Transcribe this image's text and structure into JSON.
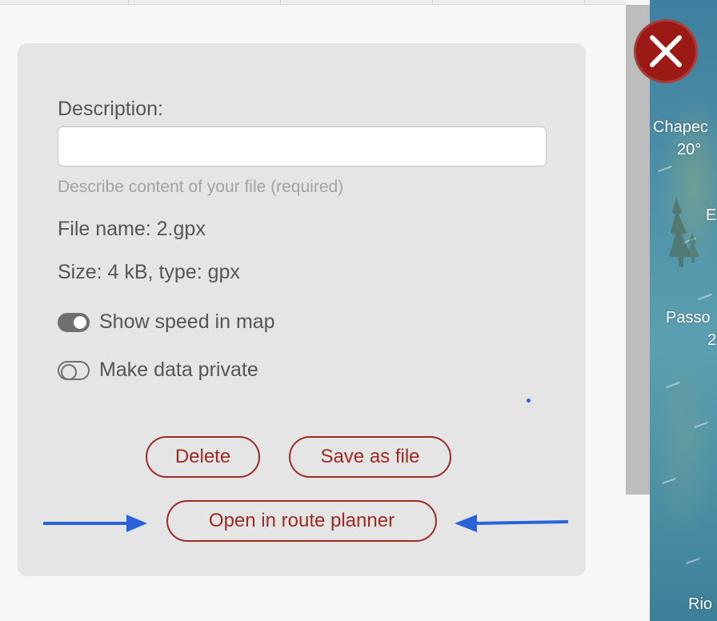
{
  "form": {
    "description_label": "Description:",
    "description_value": "",
    "description_placeholder": "",
    "description_hint": "Describe content of your file (required)",
    "file_name": "File name: 2.gpx",
    "size_type": "Size: 4 kB, type: gpx",
    "toggles": [
      {
        "label": "Show speed in map",
        "on": true
      },
      {
        "label": "Make data private",
        "on": false
      }
    ]
  },
  "buttons": {
    "delete": "Delete",
    "save_as_file": "Save as file",
    "open_route_planner": "Open in route planner"
  },
  "map": {
    "labels": [
      "Chapec",
      "20°",
      "E",
      "Passo",
      "2",
      "Rio"
    ]
  },
  "colors": {
    "accent": "#9b2a23",
    "close_bg": "#9b1a16",
    "arrow": "#2a62d8",
    "card_bg": "#e5e5e6"
  },
  "icons": {
    "close": "close-x-icon",
    "arrow": "arrow-right-icon / arrow-left-icon"
  }
}
